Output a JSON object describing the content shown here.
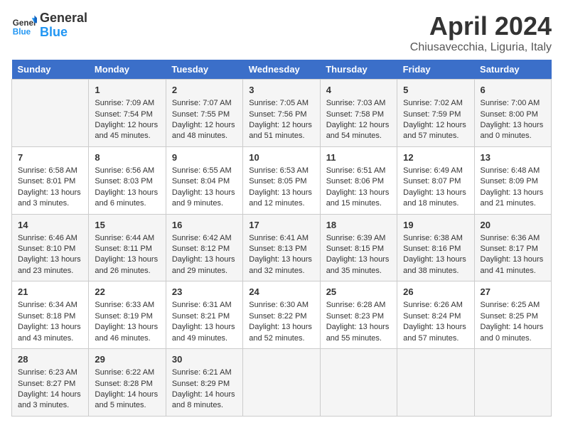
{
  "header": {
    "logo_line1": "General",
    "logo_line2": "Blue",
    "title": "April 2024",
    "subtitle": "Chiusavecchia, Liguria, Italy"
  },
  "days_of_week": [
    "Sunday",
    "Monday",
    "Tuesday",
    "Wednesday",
    "Thursday",
    "Friday",
    "Saturday"
  ],
  "weeks": [
    [
      {
        "day": "",
        "content": ""
      },
      {
        "day": "1",
        "content": "Sunrise: 7:09 AM\nSunset: 7:54 PM\nDaylight: 12 hours\nand 45 minutes."
      },
      {
        "day": "2",
        "content": "Sunrise: 7:07 AM\nSunset: 7:55 PM\nDaylight: 12 hours\nand 48 minutes."
      },
      {
        "day": "3",
        "content": "Sunrise: 7:05 AM\nSunset: 7:56 PM\nDaylight: 12 hours\nand 51 minutes."
      },
      {
        "day": "4",
        "content": "Sunrise: 7:03 AM\nSunset: 7:58 PM\nDaylight: 12 hours\nand 54 minutes."
      },
      {
        "day": "5",
        "content": "Sunrise: 7:02 AM\nSunset: 7:59 PM\nDaylight: 12 hours\nand 57 minutes."
      },
      {
        "day": "6",
        "content": "Sunrise: 7:00 AM\nSunset: 8:00 PM\nDaylight: 13 hours\nand 0 minutes."
      }
    ],
    [
      {
        "day": "7",
        "content": "Sunrise: 6:58 AM\nSunset: 8:01 PM\nDaylight: 13 hours\nand 3 minutes."
      },
      {
        "day": "8",
        "content": "Sunrise: 6:56 AM\nSunset: 8:03 PM\nDaylight: 13 hours\nand 6 minutes."
      },
      {
        "day": "9",
        "content": "Sunrise: 6:55 AM\nSunset: 8:04 PM\nDaylight: 13 hours\nand 9 minutes."
      },
      {
        "day": "10",
        "content": "Sunrise: 6:53 AM\nSunset: 8:05 PM\nDaylight: 13 hours\nand 12 minutes."
      },
      {
        "day": "11",
        "content": "Sunrise: 6:51 AM\nSunset: 8:06 PM\nDaylight: 13 hours\nand 15 minutes."
      },
      {
        "day": "12",
        "content": "Sunrise: 6:49 AM\nSunset: 8:07 PM\nDaylight: 13 hours\nand 18 minutes."
      },
      {
        "day": "13",
        "content": "Sunrise: 6:48 AM\nSunset: 8:09 PM\nDaylight: 13 hours\nand 21 minutes."
      }
    ],
    [
      {
        "day": "14",
        "content": "Sunrise: 6:46 AM\nSunset: 8:10 PM\nDaylight: 13 hours\nand 23 minutes."
      },
      {
        "day": "15",
        "content": "Sunrise: 6:44 AM\nSunset: 8:11 PM\nDaylight: 13 hours\nand 26 minutes."
      },
      {
        "day": "16",
        "content": "Sunrise: 6:42 AM\nSunset: 8:12 PM\nDaylight: 13 hours\nand 29 minutes."
      },
      {
        "day": "17",
        "content": "Sunrise: 6:41 AM\nSunset: 8:13 PM\nDaylight: 13 hours\nand 32 minutes."
      },
      {
        "day": "18",
        "content": "Sunrise: 6:39 AM\nSunset: 8:15 PM\nDaylight: 13 hours\nand 35 minutes."
      },
      {
        "day": "19",
        "content": "Sunrise: 6:38 AM\nSunset: 8:16 PM\nDaylight: 13 hours\nand 38 minutes."
      },
      {
        "day": "20",
        "content": "Sunrise: 6:36 AM\nSunset: 8:17 PM\nDaylight: 13 hours\nand 41 minutes."
      }
    ],
    [
      {
        "day": "21",
        "content": "Sunrise: 6:34 AM\nSunset: 8:18 PM\nDaylight: 13 hours\nand 43 minutes."
      },
      {
        "day": "22",
        "content": "Sunrise: 6:33 AM\nSunset: 8:19 PM\nDaylight: 13 hours\nand 46 minutes."
      },
      {
        "day": "23",
        "content": "Sunrise: 6:31 AM\nSunset: 8:21 PM\nDaylight: 13 hours\nand 49 minutes."
      },
      {
        "day": "24",
        "content": "Sunrise: 6:30 AM\nSunset: 8:22 PM\nDaylight: 13 hours\nand 52 minutes."
      },
      {
        "day": "25",
        "content": "Sunrise: 6:28 AM\nSunset: 8:23 PM\nDaylight: 13 hours\nand 55 minutes."
      },
      {
        "day": "26",
        "content": "Sunrise: 6:26 AM\nSunset: 8:24 PM\nDaylight: 13 hours\nand 57 minutes."
      },
      {
        "day": "27",
        "content": "Sunrise: 6:25 AM\nSunset: 8:25 PM\nDaylight: 14 hours\nand 0 minutes."
      }
    ],
    [
      {
        "day": "28",
        "content": "Sunrise: 6:23 AM\nSunset: 8:27 PM\nDaylight: 14 hours\nand 3 minutes."
      },
      {
        "day": "29",
        "content": "Sunrise: 6:22 AM\nSunset: 8:28 PM\nDaylight: 14 hours\nand 5 minutes."
      },
      {
        "day": "30",
        "content": "Sunrise: 6:21 AM\nSunset: 8:29 PM\nDaylight: 14 hours\nand 8 minutes."
      },
      {
        "day": "",
        "content": ""
      },
      {
        "day": "",
        "content": ""
      },
      {
        "day": "",
        "content": ""
      },
      {
        "day": "",
        "content": ""
      }
    ]
  ]
}
